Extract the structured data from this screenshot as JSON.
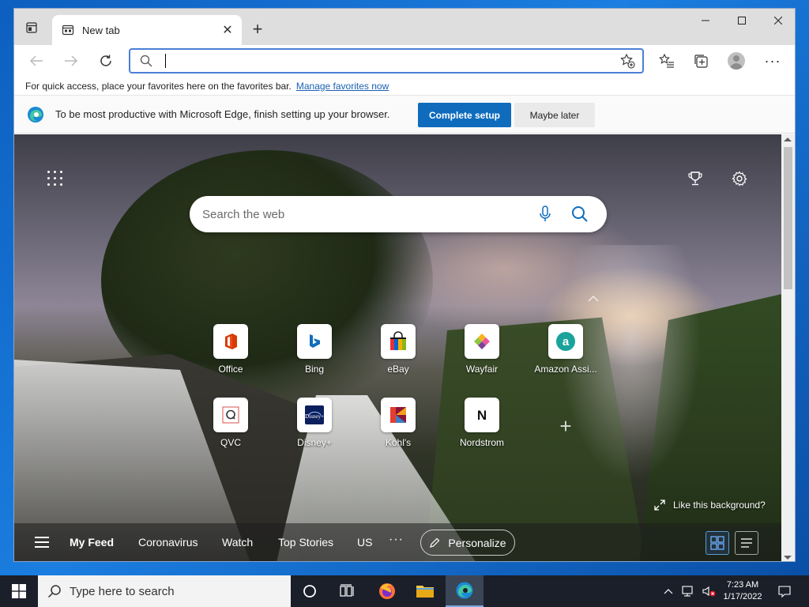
{
  "browser": {
    "tab": {
      "title": "New tab",
      "close": "✕"
    },
    "new_tab": "+",
    "window_controls": {
      "minimize": "—",
      "maximize": "☐",
      "close": "✕"
    },
    "address": {
      "value": "",
      "placeholder": ""
    },
    "more_menu": "···"
  },
  "favorites_bar": {
    "message": "For quick access, place your favorites here on the favorites bar.",
    "link": "Manage favorites now"
  },
  "infobar": {
    "message": "To be most productive with Microsoft Edge, finish setting up your browser.",
    "primary": "Complete setup",
    "secondary": "Maybe later"
  },
  "ntp": {
    "search_placeholder": "Search the web",
    "tiles": [
      {
        "label": "Office",
        "icon": "office-icon"
      },
      {
        "label": "Bing",
        "icon": "bing-icon"
      },
      {
        "label": "eBay",
        "icon": "ebay-icon"
      },
      {
        "label": "Wayfair",
        "icon": "wayfair-icon"
      },
      {
        "label": "Amazon Assi...",
        "icon": "amazon-icon"
      },
      {
        "label": "QVC",
        "icon": "qvc-icon"
      },
      {
        "label": "Disney+",
        "icon": "disney-icon"
      },
      {
        "label": "Kohl's",
        "icon": "kohls-icon"
      },
      {
        "label": "Nordstrom",
        "icon": "nordstrom-icon"
      }
    ],
    "add_tile": "+",
    "like_background": "Like this background?",
    "feed": {
      "items": [
        "My Feed",
        "Coronavirus",
        "Watch",
        "Top Stories",
        "US"
      ],
      "more": "···",
      "personalize": "Personalize"
    }
  },
  "taskbar": {
    "search_placeholder": "Type here to search",
    "clock_time": "7:23 AM",
    "clock_date": "1/17/2022"
  },
  "colors": {
    "accent": "#0f6cbd",
    "address_border": "#4a7fd6",
    "taskbar": "#1b1f2a"
  }
}
